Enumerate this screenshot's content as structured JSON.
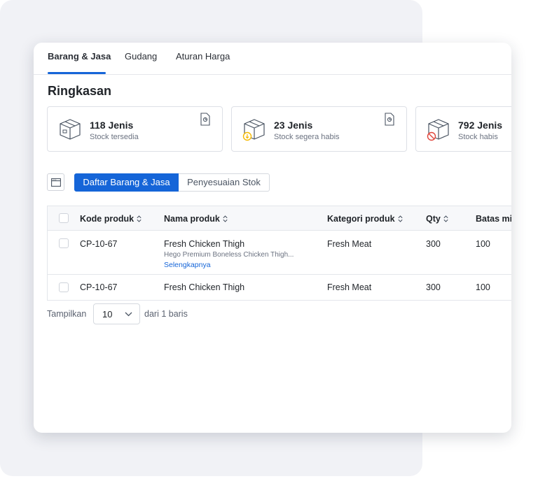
{
  "tabs": [
    {
      "label": "Barang & Jasa",
      "active": true
    },
    {
      "label": "Gudang",
      "active": false
    },
    {
      "label": "Aturan Harga",
      "active": false
    }
  ],
  "summary": {
    "title": "Ringkasan",
    "cards": [
      {
        "value": "118 Jenis",
        "label": "Stock tersedia",
        "icon": "box-icon"
      },
      {
        "value": "23 Jenis",
        "label": "Stock segera habis",
        "icon": "box-warning-icon"
      },
      {
        "value": "792 Jenis",
        "label": "Stock habis",
        "icon": "box-empty-icon"
      }
    ]
  },
  "toolbar": {
    "segments": [
      {
        "label": "Daftar Barang & Jasa",
        "active": true
      },
      {
        "label": "Penyesuaian Stok",
        "active": false
      }
    ]
  },
  "table": {
    "columns": [
      "Kode produk",
      "Nama produk",
      "Kategori produk",
      "Qty",
      "Batas mi"
    ],
    "rows": [
      {
        "code": "CP-10-67",
        "name": "Fresh Chicken Thigh",
        "description": "Hego Premium Boneless Chicken Thigh...",
        "more": "Selengkapnya",
        "category": "Fresh Meat",
        "qty": "300",
        "limit": "100"
      },
      {
        "code": "CP-10-67",
        "name": "Fresh Chicken Thigh",
        "category": "Fresh Meat",
        "qty": "300",
        "limit": "100"
      }
    ]
  },
  "pager": {
    "show_label": "Tampilkan",
    "page_size": "10",
    "of_label": "dari 1 baris"
  },
  "colors": {
    "accent": "#1565d8",
    "warning": "#f5b800",
    "danger": "#e0463c"
  }
}
